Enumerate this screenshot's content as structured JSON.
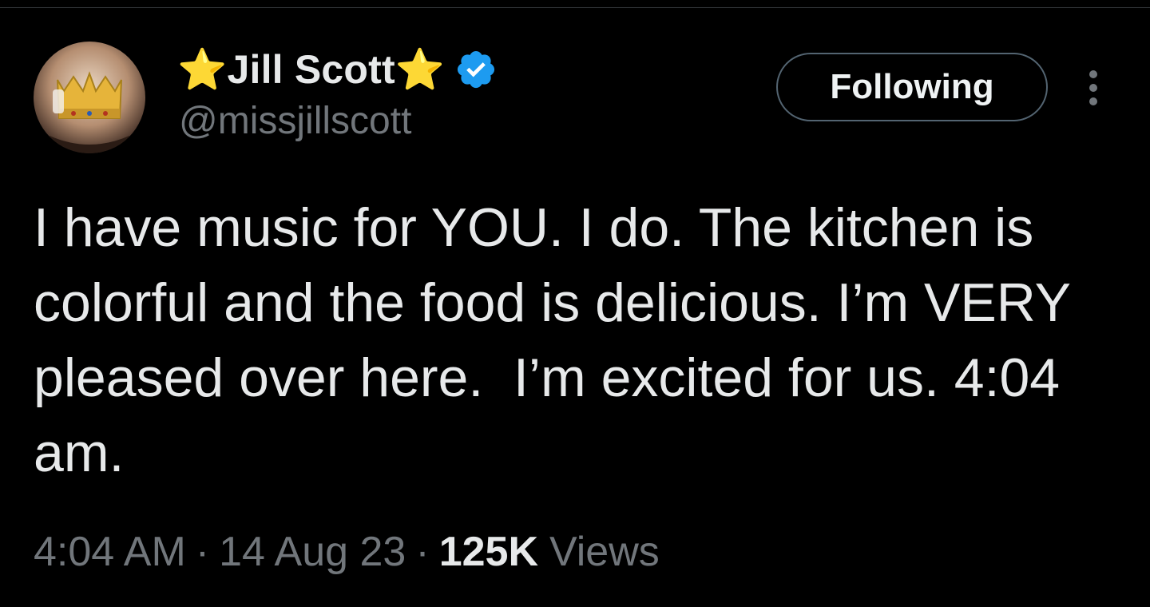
{
  "author": {
    "display_name": "Jill Scott",
    "star_left": "⭐",
    "star_right": "⭐",
    "handle": "@missjillscott",
    "verified": true
  },
  "actions": {
    "follow_label": "Following"
  },
  "tweet": {
    "text": "I have music for YOU. I do. The kitchen is colorful and the food is delicious. I’m VERY pleased over here.  I’m excited for us. 4:04 am."
  },
  "meta": {
    "time": "4:04 AM",
    "date": "14 Aug 23",
    "views_count": "125K",
    "views_label": "Views",
    "separator": "·"
  },
  "colors": {
    "background": "#000000",
    "primary_text": "#e7e9ea",
    "secondary_text": "#71767b",
    "verified_blue": "#1d9bf0",
    "button_border": "#536471"
  },
  "icons": {
    "verified": "verified-badge-icon",
    "more": "more-dots-icon"
  }
}
